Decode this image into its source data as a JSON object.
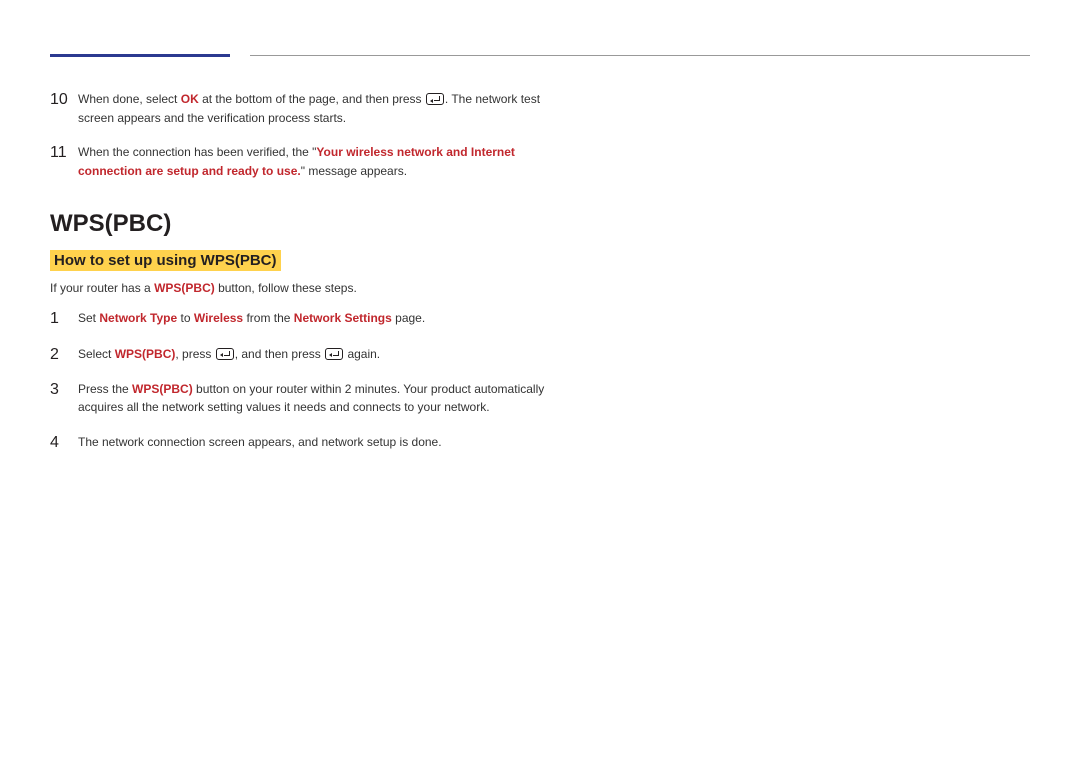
{
  "steps_top": [
    {
      "num": "10",
      "parts": [
        {
          "t": "When done, select "
        },
        {
          "t": "OK",
          "cls": "bold-red"
        },
        {
          "t": " at the bottom of the page, and then press "
        },
        {
          "icon": "enter"
        },
        {
          "t": ". The network test screen appears and the verification process starts."
        }
      ]
    },
    {
      "num": "11",
      "parts": [
        {
          "t": "When the connection has been verified, the \""
        },
        {
          "t": "Your wireless network and Internet connection are setup and ready to use.",
          "cls": "bold-red"
        },
        {
          "t": "\" message appears."
        }
      ]
    }
  ],
  "section_title": "WPS(PBC)",
  "sub_title": "How to set up using WPS(PBC)",
  "intro": {
    "parts": [
      {
        "t": "If your router has a "
      },
      {
        "t": "WPS(PBC)",
        "cls": "bold-red"
      },
      {
        "t": " button, follow these steps."
      }
    ]
  },
  "steps_wps": [
    {
      "num": "1",
      "parts": [
        {
          "t": "Set "
        },
        {
          "t": "Network Type",
          "cls": "bold-red"
        },
        {
          "t": " to "
        },
        {
          "t": "Wireless",
          "cls": "bold-red"
        },
        {
          "t": " from the "
        },
        {
          "t": "Network Settings",
          "cls": "bold-red"
        },
        {
          "t": " page."
        }
      ]
    },
    {
      "num": "2",
      "parts": [
        {
          "t": "Select "
        },
        {
          "t": "WPS(PBC)",
          "cls": "bold-red"
        },
        {
          "t": ", press "
        },
        {
          "icon": "enter"
        },
        {
          "t": ", and then press "
        },
        {
          "icon": "enter"
        },
        {
          "t": " again."
        }
      ]
    },
    {
      "num": "3",
      "parts": [
        {
          "t": "Press the "
        },
        {
          "t": "WPS(PBC)",
          "cls": "bold-red"
        },
        {
          "t": " button on your router within 2 minutes. Your product automatically acquires all the network setting values it needs and connects to your network."
        }
      ]
    },
    {
      "num": "4",
      "parts": [
        {
          "t": "The network connection screen appears, and network setup is done."
        }
      ]
    }
  ]
}
